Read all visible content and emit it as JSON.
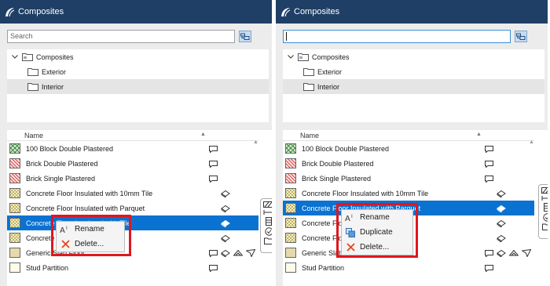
{
  "window": {
    "title": "Composites"
  },
  "search": {
    "placeholder": "Search",
    "value": ""
  },
  "tree": {
    "items": [
      {
        "label": "Composites"
      },
      {
        "label": "Exterior"
      },
      {
        "label": "Interior"
      }
    ]
  },
  "list": {
    "column_name": "Name",
    "rows": [
      {
        "label": "100 Block Double Plastered"
      },
      {
        "label": "Brick Double Plastered"
      },
      {
        "label": "Brick Single Plastered"
      },
      {
        "label": "Concrete Floor Insulated with 10mm Tile"
      },
      {
        "label": "Concrete Floor Insulated with Parquet"
      },
      {
        "label": "Concrete Floor Insulated with Tile"
      },
      {
        "label": "Concrete Floor Insulated"
      },
      {
        "label": "Generic Slab Floor"
      },
      {
        "label": "Stud Partition"
      }
    ]
  },
  "left_menu": {
    "items": [
      {
        "label": "Rename",
        "icon": "rename-icon"
      },
      {
        "label": "Delete...",
        "icon": "delete-icon"
      }
    ]
  },
  "right_menu": {
    "items": [
      {
        "label": "Rename",
        "icon": "rename-icon"
      },
      {
        "label": "Duplicate",
        "icon": "duplicate-icon"
      },
      {
        "label": "Delete...",
        "icon": "delete-icon"
      }
    ]
  },
  "colors": {
    "titlebar": "#1f3f66",
    "selection": "#0a72d1",
    "highlight": "#e0161f"
  }
}
